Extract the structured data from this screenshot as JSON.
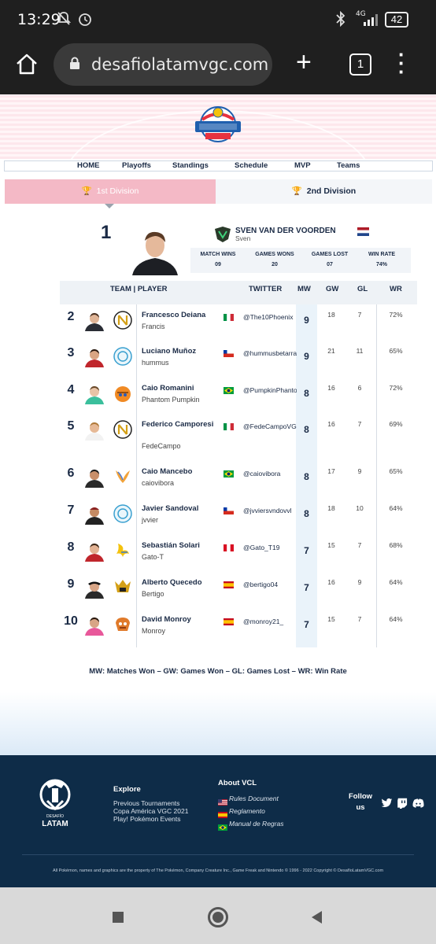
{
  "statusbar": {
    "time": "13:29",
    "network": "4G",
    "battery": "42"
  },
  "browser": {
    "url": "desafiolatamvgc.com",
    "tab_count": "1"
  },
  "nav": {
    "items": [
      "HOME",
      "Playoffs",
      "Standings",
      "Schedule",
      "MVP",
      "Teams"
    ]
  },
  "divisions": {
    "first": "1st Division",
    "second": "2nd Division"
  },
  "champion": {
    "rank": "1",
    "name": "SVEN VAN DER VOORDEN",
    "nick": "Sven",
    "stats": [
      {
        "label": "MATCH WINS",
        "value": "09"
      },
      {
        "label": "GAMES WONS",
        "value": "20"
      },
      {
        "label": "GAMES LOST",
        "value": "07"
      },
      {
        "label": "WIN RATE",
        "value": "74%"
      }
    ]
  },
  "table": {
    "headers": {
      "team_player": "TEAM | PLAYER",
      "twitter": "TWITTER",
      "mw": "MW",
      "gw": "GW",
      "gl": "GL",
      "wr": "WR"
    },
    "rows": [
      {
        "rank": "2",
        "name": "Francesco Deiana",
        "nick": "Francis",
        "twitter": "@The10Phoenix",
        "mw": "9",
        "gw": "18",
        "gl": "7",
        "wr": "72%"
      },
      {
        "rank": "3",
        "name": "Luciano Muñoz",
        "nick": "hummus",
        "twitter": "@hummusbetarraga",
        "mw": "9",
        "gw": "21",
        "gl": "11",
        "wr": "65%"
      },
      {
        "rank": "4",
        "name": "Caio Romanini",
        "nick": "Phantom Pumpkin",
        "twitter": "@PumpkinPhantom",
        "mw": "8",
        "gw": "16",
        "gl": "6",
        "wr": "72%"
      },
      {
        "rank": "5",
        "name": "Federico Camporesi",
        "nick": "FedeCampo",
        "twitter": "@FedeCampoVGC",
        "mw": "8",
        "gw": "16",
        "gl": "7",
        "wr": "69%"
      },
      {
        "rank": "6",
        "name": "Caio Mancebo",
        "nick": "caiovibora",
        "twitter": "@caiovibora",
        "mw": "8",
        "gw": "17",
        "gl": "9",
        "wr": "65%"
      },
      {
        "rank": "7",
        "name": "Javier Sandoval",
        "nick": "jvvier",
        "twitter": "@jvviersvndovvl",
        "mw": "8",
        "gw": "18",
        "gl": "10",
        "wr": "64%"
      },
      {
        "rank": "8",
        "name": "Sebastián Solari",
        "nick": "Gato-T",
        "twitter": "@Gato_T19",
        "mw": "7",
        "gw": "15",
        "gl": "7",
        "wr": "68%"
      },
      {
        "rank": "9",
        "name": "Alberto Quecedo",
        "nick": "Bertigo",
        "twitter": "@bertigo04",
        "mw": "7",
        "gw": "16",
        "gl": "9",
        "wr": "64%"
      },
      {
        "rank": "10",
        "name": "David Monroy",
        "nick": "Monroy",
        "twitter": "@monroy21_",
        "mw": "7",
        "gw": "15",
        "gl": "7",
        "wr": "64%"
      }
    ]
  },
  "legend": "MW: Matches Won  –  GW: Games Won  –  GL: Games Lost  –  WR: Win Rate",
  "footer": {
    "explore_title": "Explore",
    "explore_links": [
      "Previous Tournaments",
      "Copa América VGC 2021",
      "Play! Pokémon Events"
    ],
    "about_title": "About VCL",
    "about_links": [
      "Rules Document",
      "Reglamento",
      "Manual de Regras"
    ],
    "follow_line1": "Follow",
    "follow_line2": "us",
    "copyright": "All Pokémon, names and graphics are the property of The Pokémon, Company Creature Inc., Game Freak and Nintendo © 1996 - 2022 Copyright © DesafíoLatamVGC.com"
  }
}
